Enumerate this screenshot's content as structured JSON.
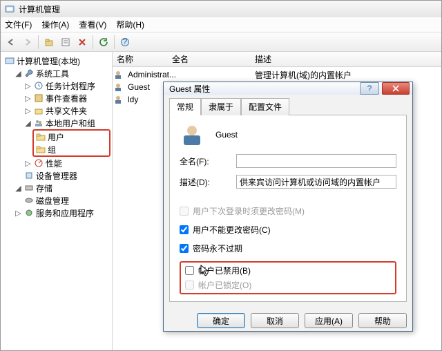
{
  "window": {
    "title": "计算机管理"
  },
  "menu": {
    "file": "文件(F)",
    "action": "操作(A)",
    "view": "查看(V)",
    "help": "帮助(H)"
  },
  "tree": {
    "root": "计算机管理(本地)",
    "sys_tools": "系统工具",
    "task_sched": "任务计划程序",
    "event_viewer": "事件查看器",
    "shared": "共享文件夹",
    "local_users": "本地用户和组",
    "users": "用户",
    "groups": "组",
    "perf": "性能",
    "dev_mgr": "设备管理器",
    "storage": "存储",
    "disk_mgmt": "磁盘管理",
    "services": "服务和应用程序"
  },
  "list": {
    "col_name": "名称",
    "col_fullname": "全名",
    "col_desc": "描述",
    "rows": [
      {
        "name": "Administrat...",
        "full": "",
        "desc": "管理计算机(域)的内置帐户"
      },
      {
        "name": "Guest",
        "full": "",
        "desc": "供来宾访问计算机或访问域的内"
      },
      {
        "name": "ldy",
        "full": "",
        "desc": ""
      }
    ]
  },
  "dialog": {
    "title": "Guest 属性",
    "tabs": {
      "general": "常规",
      "member": "隶属于",
      "profile": "配置文件"
    },
    "account_name": "Guest",
    "fullname_label": "全名(F):",
    "fullname_value": "",
    "desc_label": "描述(D):",
    "desc_value": "供来宾访问计算机或访问域的内置帐户",
    "chk_mustchange": "用户下次登录时须更改密码(M)",
    "chk_cannotchange": "用户不能更改密码(C)",
    "chk_neverexpire": "密码永不过期",
    "chk_disabled": "帐户已禁用(B)",
    "chk_locked": "帐户已锁定(O)",
    "btn_ok": "确定",
    "btn_cancel": "取消",
    "btn_apply": "应用(A)",
    "btn_help": "帮助"
  }
}
